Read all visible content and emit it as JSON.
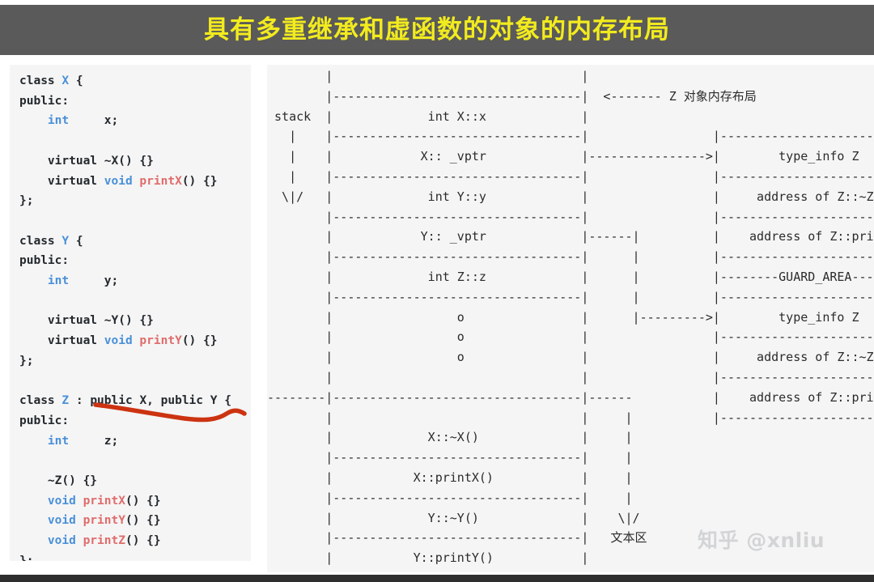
{
  "title": {
    "text": "具有多重继承和虚函数的对象的内存布局",
    "color": "#f2eb1e",
    "bar_color": "#5a5a5a"
  },
  "code_panel": {
    "language": "cpp",
    "background": "#f5f5f5",
    "colors": {
      "keyword": "#24292e",
      "type": "#4a90d9",
      "function": "#e06c6c"
    },
    "annotation": {
      "kind": "hand-drawn-underline",
      "color": "#cc3311",
      "target_text": "public X, public Y"
    },
    "lines": [
      "class X {",
      "public:",
      "    int     x;",
      "",
      "    virtual ~X() {}",
      "    virtual void printX() {}",
      "};",
      "",
      "class Y {",
      "public:",
      "    int     y;",
      "",
      "    virtual ~Y() {}",
      "    virtual void printY() {}",
      "};",
      "",
      "class Z : public X, public Y {",
      "public:",
      "    int     z;",
      "",
      "    ~Z() {}",
      "    void printX() {}",
      "    void printY() {}",
      "    void printZ() {}",
      "};"
    ]
  },
  "diagram": {
    "background": "#f5f5f5",
    "stack_label": "stack",
    "stack_arrow": "\\|/",
    "object_note": "<------- Z 对象内存布局",
    "text_section_label": "文本区",
    "text_section_arrow": "\\|/",
    "object_slots": [
      "int X::x",
      "X:: _vptr",
      "int Y::y",
      "Y:: _vptr",
      "int Z::z",
      "o",
      "o",
      "o"
    ],
    "vtable_1": [
      "type_info Z",
      "address of Z::~Z()",
      "address of Z::printX"
    ],
    "guard_area_label": "GUARD_AREA",
    "vtable_2": [
      "type_info Z",
      "address of Z::~Z()",
      "address of Z::printY"
    ],
    "text_section_slots": [
      "X::~X()",
      "X::printX()",
      "Y::~Y()",
      "Y::printY()"
    ],
    "ascii_rows": [
      "        |                                  |",
      "        |----------------------------------|  <------- Z 对象内存布局",
      " stack  |             int X::x             |",
      "   |    |----------------------------------|                 |---------------------------",
      "   |    |            X:: _vptr             |---------------->|        type_info Z",
      "   |    |----------------------------------|                 |---------------------------",
      "  \\|/   |             int Y::y             |                 |     address of Z::~Z()",
      "        |----------------------------------|                 |---------------------------",
      "        |            Y:: _vptr             |------|          |    address of Z::printX",
      "        |----------------------------------|      |          |---------------------------",
      "        |             int Z::z             |      |          |--------GUARD_AREA---------",
      "        |----------------------------------|      |          |---------------------------",
      "        |                 o                |      |--------->|        type_info Z",
      "        |                 o                |                 |---------------------------",
      "        |                 o                |                 |     address of Z::~Z()",
      "        |                                  |                 |---------------------------",
      "--------|----------------------------------|------           |    address of Z::printY",
      "        |                                  |     |           |---------------------------",
      "        |             X::~X()              |     |",
      "        |----------------------------------|     |",
      "        |           X::printX()            |     |",
      "        |----------------------------------|     |",
      "        |             Y::~Y()              |    \\|/",
      "        |----------------------------------|   文本区",
      "        |           Y::printY()            |",
      "        |----------------------------------|"
    ]
  },
  "watermark": {
    "text": "知乎 @xnliu"
  }
}
